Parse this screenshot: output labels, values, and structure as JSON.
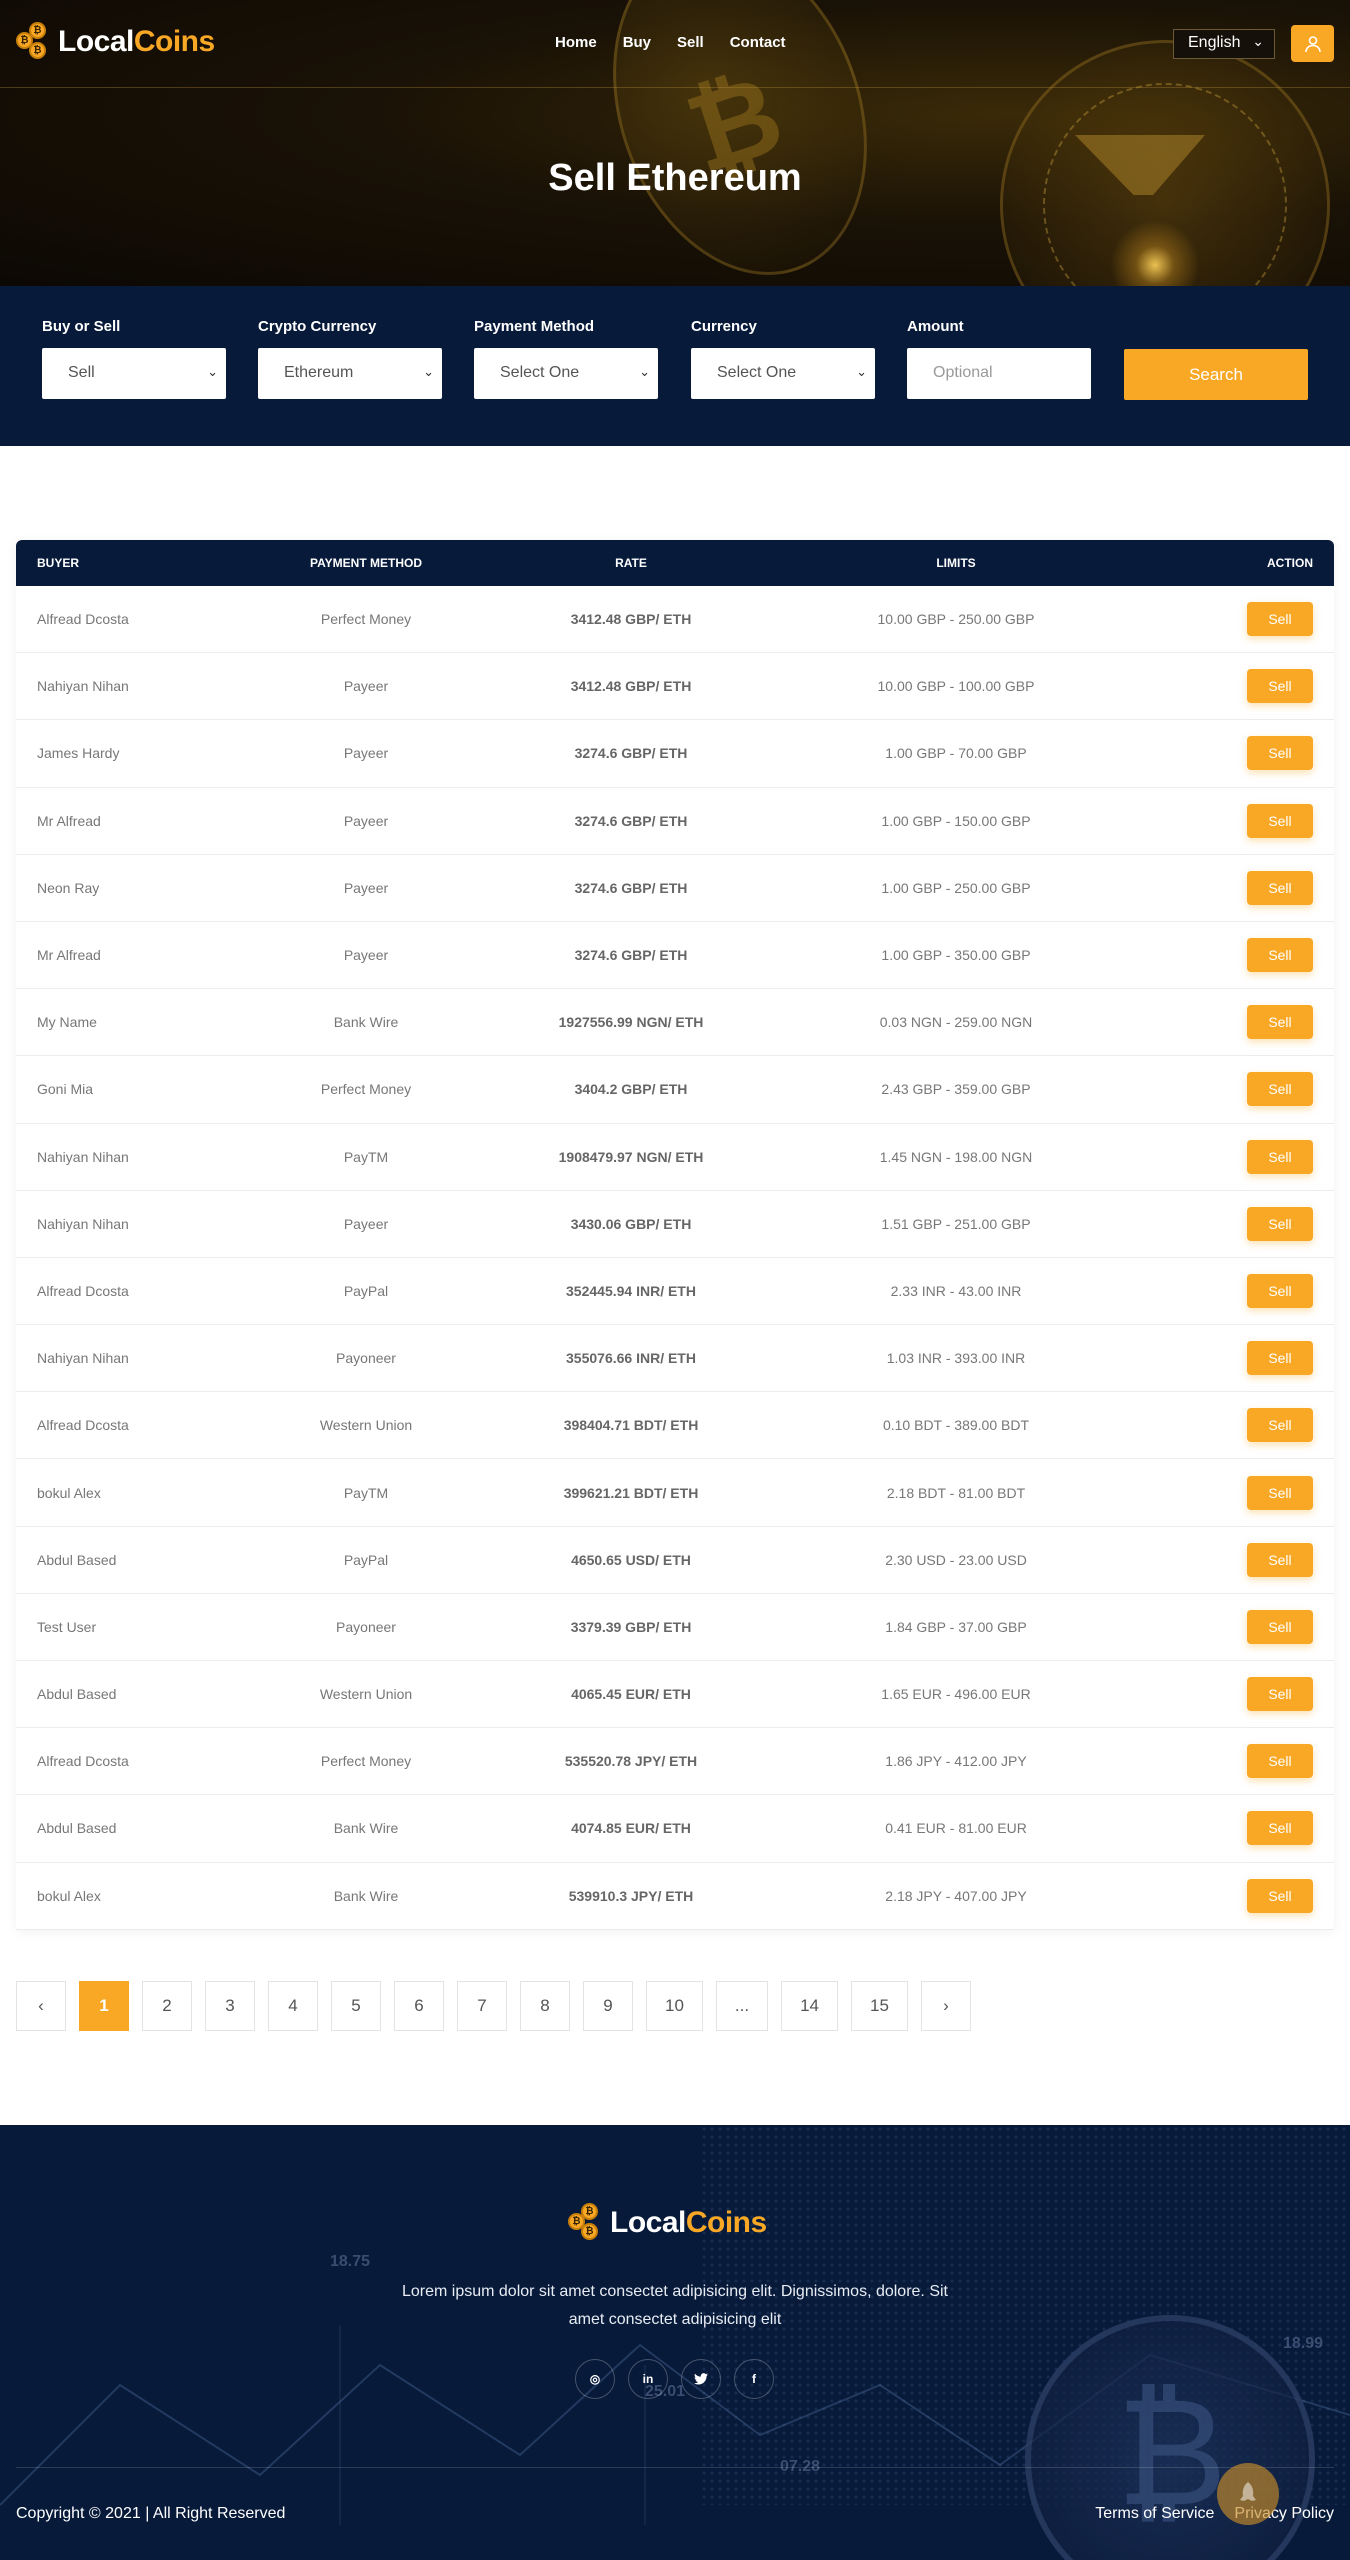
{
  "brand": {
    "name_a": "Local",
    "name_b": "Coins",
    "accent": "#f9a826",
    "navy": "#071a3a"
  },
  "nav": {
    "items": [
      "Home",
      "Buy",
      "Sell",
      "Contact"
    ],
    "language": "English"
  },
  "hero": {
    "title": "Sell Ethereum"
  },
  "filter": {
    "buy_sell": {
      "label": "Buy or Sell",
      "value": "Sell"
    },
    "crypto": {
      "label": "Crypto Currency",
      "value": "Ethereum"
    },
    "payment": {
      "label": "Payment Method",
      "value": "Select One"
    },
    "currency": {
      "label": "Currency",
      "value": "Select One"
    },
    "amount": {
      "label": "Amount",
      "placeholder": "Optional"
    },
    "search_label": "Search"
  },
  "table": {
    "headers": [
      "BUYER",
      "PAYMENT METHOD",
      "RATE",
      "LIMITS",
      "ACTION"
    ],
    "action_label": "Sell",
    "rows": [
      [
        "Alfread Dcosta",
        "Perfect Money",
        "3412.48 GBP/ ETH",
        "10.00 GBP - 250.00 GBP"
      ],
      [
        "Nahiyan Nihan",
        "Payeer",
        "3412.48 GBP/ ETH",
        "10.00 GBP - 100.00 GBP"
      ],
      [
        "James Hardy",
        "Payeer",
        "3274.6 GBP/ ETH",
        "1.00 GBP - 70.00 GBP"
      ],
      [
        "Mr Alfread",
        "Payeer",
        "3274.6 GBP/ ETH",
        "1.00 GBP - 150.00 GBP"
      ],
      [
        "Neon Ray",
        "Payeer",
        "3274.6 GBP/ ETH",
        "1.00 GBP - 250.00 GBP"
      ],
      [
        "Mr Alfread",
        "Payeer",
        "3274.6 GBP/ ETH",
        "1.00 GBP - 350.00 GBP"
      ],
      [
        "My Name",
        "Bank Wire",
        "1927556.99 NGN/ ETH",
        "0.03 NGN - 259.00 NGN"
      ],
      [
        "Goni Mia",
        "Perfect Money",
        "3404.2 GBP/ ETH",
        "2.43 GBP - 359.00 GBP"
      ],
      [
        "Nahiyan Nihan",
        "PayTM",
        "1908479.97 NGN/ ETH",
        "1.45 NGN - 198.00 NGN"
      ],
      [
        "Nahiyan Nihan",
        "Payeer",
        "3430.06 GBP/ ETH",
        "1.51 GBP - 251.00 GBP"
      ],
      [
        "Alfread Dcosta",
        "PayPal",
        "352445.94 INR/ ETH",
        "2.33 INR - 43.00 INR"
      ],
      [
        "Nahiyan Nihan",
        "Payoneer",
        "355076.66 INR/ ETH",
        "1.03 INR - 393.00 INR"
      ],
      [
        "Alfread Dcosta",
        "Western Union",
        "398404.71 BDT/ ETH",
        "0.10 BDT - 389.00 BDT"
      ],
      [
        "bokul Alex",
        "PayTM",
        "399621.21 BDT/ ETH",
        "2.18 BDT - 81.00 BDT"
      ],
      [
        "Abdul Based",
        "PayPal",
        "4650.65 USD/ ETH",
        "2.30 USD - 23.00 USD"
      ],
      [
        "Test User",
        "Payoneer",
        "3379.39 GBP/ ETH",
        "1.84 GBP - 37.00 GBP"
      ],
      [
        "Abdul Based",
        "Western Union",
        "4065.45 EUR/ ETH",
        "1.65 EUR - 496.00 EUR"
      ],
      [
        "Alfread Dcosta",
        "Perfect Money",
        "535520.78 JPY/ ETH",
        "1.86 JPY - 412.00 JPY"
      ],
      [
        "Abdul Based",
        "Bank Wire",
        "4074.85 EUR/ ETH",
        "0.41 EUR - 81.00 EUR"
      ],
      [
        "bokul Alex",
        "Bank Wire",
        "539910.3 JPY/ ETH",
        "2.18 JPY - 407.00 JPY"
      ]
    ]
  },
  "pagination": {
    "prev": "‹",
    "next": "›",
    "pages": [
      "1",
      "2",
      "3",
      "4",
      "5",
      "6",
      "7",
      "8",
      "9",
      "10",
      "...",
      "14",
      "15"
    ],
    "active": "1"
  },
  "footer": {
    "description": "Lorem ipsum dolor sit amet consectet adipisicing elit. Dignissimos, dolore. Sit amet consectet adipisicing elit",
    "social": [
      {
        "icon": "instagram-icon",
        "glyph": "◎"
      },
      {
        "icon": "linkedin-icon",
        "glyph": "in"
      },
      {
        "icon": "twitter-icon",
        "glyph": "🐦"
      },
      {
        "icon": "facebook-icon",
        "glyph": "f"
      }
    ],
    "copyright": "Copyright © 2021 | All Right Reserved",
    "links": [
      "Terms of Service",
      "Privacy Policy"
    ],
    "deco_numbers": [
      "18.75",
      "25.01",
      "07.28",
      "18.99"
    ]
  }
}
